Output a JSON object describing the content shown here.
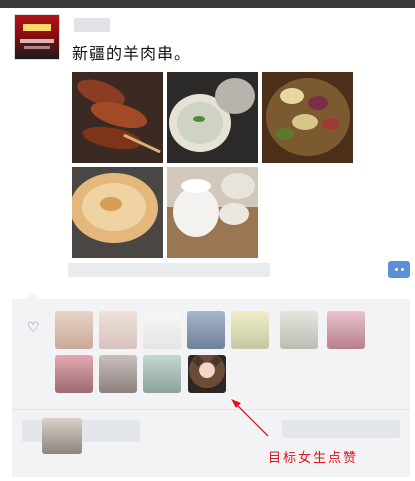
{
  "post": {
    "text": "新疆的羊肉串。"
  },
  "annotation": {
    "label": "目标女生点赞"
  },
  "icons": {
    "like": "heart-icon",
    "comment": "comment-dots-icon"
  },
  "colors": {
    "annotation_red": "#e0141e",
    "comment_button_blue": "#5b8fd6",
    "panel_gray": "#f3f3f5"
  }
}
